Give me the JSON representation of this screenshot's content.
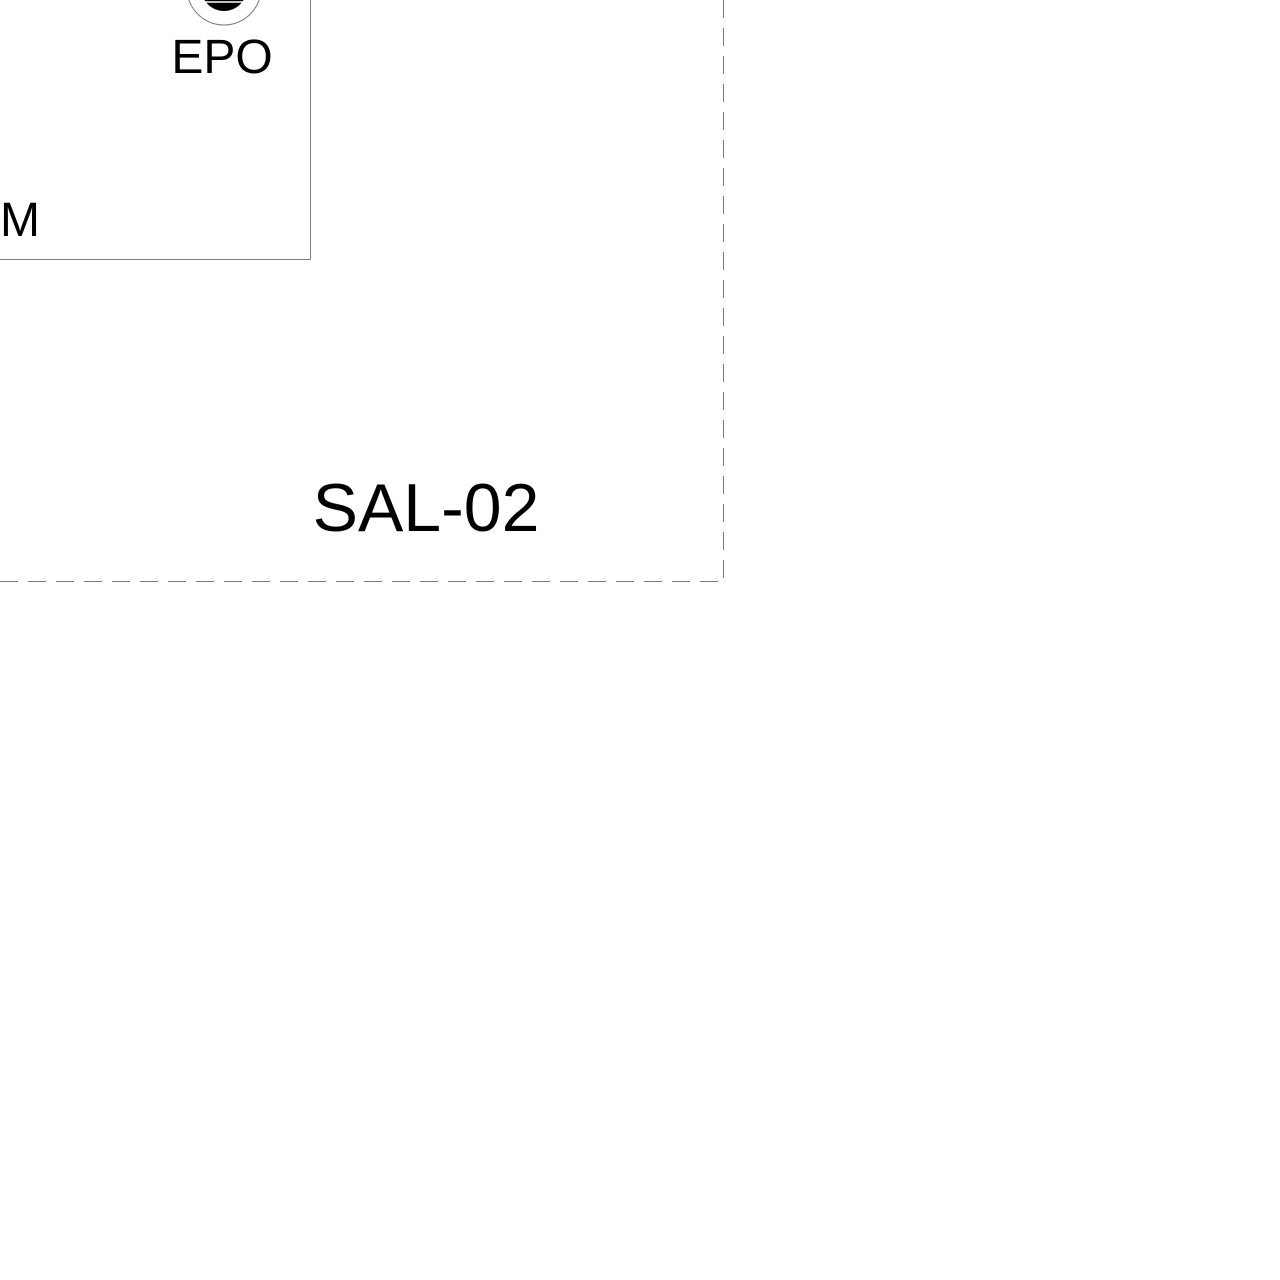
{
  "drawing": {
    "room_label": "SAL-02",
    "epo_label": "EPO",
    "partial_label": "M",
    "colors": {
      "background": "#ffffff",
      "room_boundary": "#7a7a7a",
      "panel_border": "#7a7a7a",
      "epo_fill": "#000000",
      "text": "#000000"
    },
    "icons": {
      "epo": "epo-button-icon"
    }
  }
}
